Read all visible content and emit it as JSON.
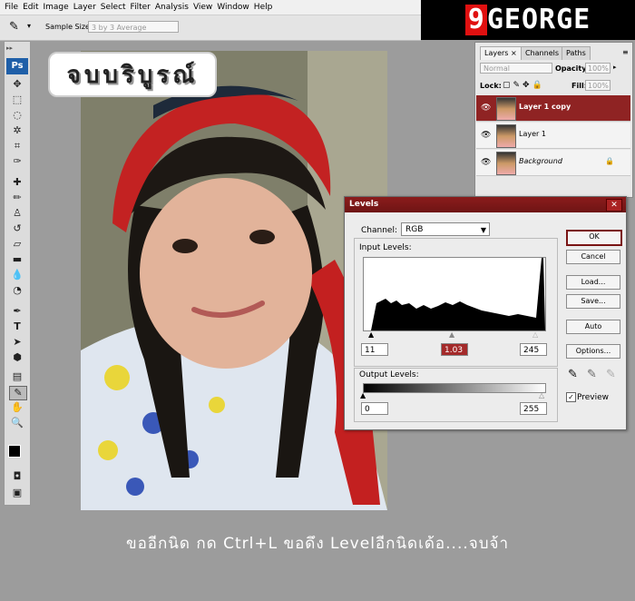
{
  "menu": [
    "File",
    "Edit",
    "Image",
    "Layer",
    "Select",
    "Filter",
    "Analysis",
    "View",
    "Window",
    "Help"
  ],
  "brand": {
    "red_part": "9",
    "white_part": "GEORGE"
  },
  "options_bar": {
    "sample_size_label": "Sample Size:",
    "sample_size_value": "3 by 3 Average"
  },
  "toolbox": {
    "logo": "Ps"
  },
  "badge_text": "จบบริบูรณ์",
  "layers_panel": {
    "tabs": [
      "Layers",
      "Channels",
      "Paths"
    ],
    "blend_mode": "Normal",
    "opacity_label": "Opacity:",
    "opacity_value": "100%",
    "lock_label": "Lock:",
    "fill_label": "Fill:",
    "fill_value": "100%",
    "layers": [
      {
        "name": "Layer 1 copy",
        "selected": true
      },
      {
        "name": "Layer 1",
        "selected": false
      },
      {
        "name": "Background",
        "selected": false
      }
    ]
  },
  "levels": {
    "title": "Levels",
    "channel_label": "Channel:",
    "channel_value": "RGB",
    "input_levels_label": "Input Levels:",
    "input_black": "11",
    "input_gamma": "1.03",
    "input_white": "245",
    "output_levels_label": "Output Levels:",
    "output_black": "0",
    "output_white": "255",
    "buttons": [
      "OK",
      "Cancel",
      "Load...",
      "Save...",
      "Auto",
      "Options..."
    ],
    "preview_label": "Preview",
    "preview_checked": true
  },
  "caption": "ขออีกนิด กด Ctrl+L ขอดึง Levelอีกนิดเด้อ....จบจ้า"
}
